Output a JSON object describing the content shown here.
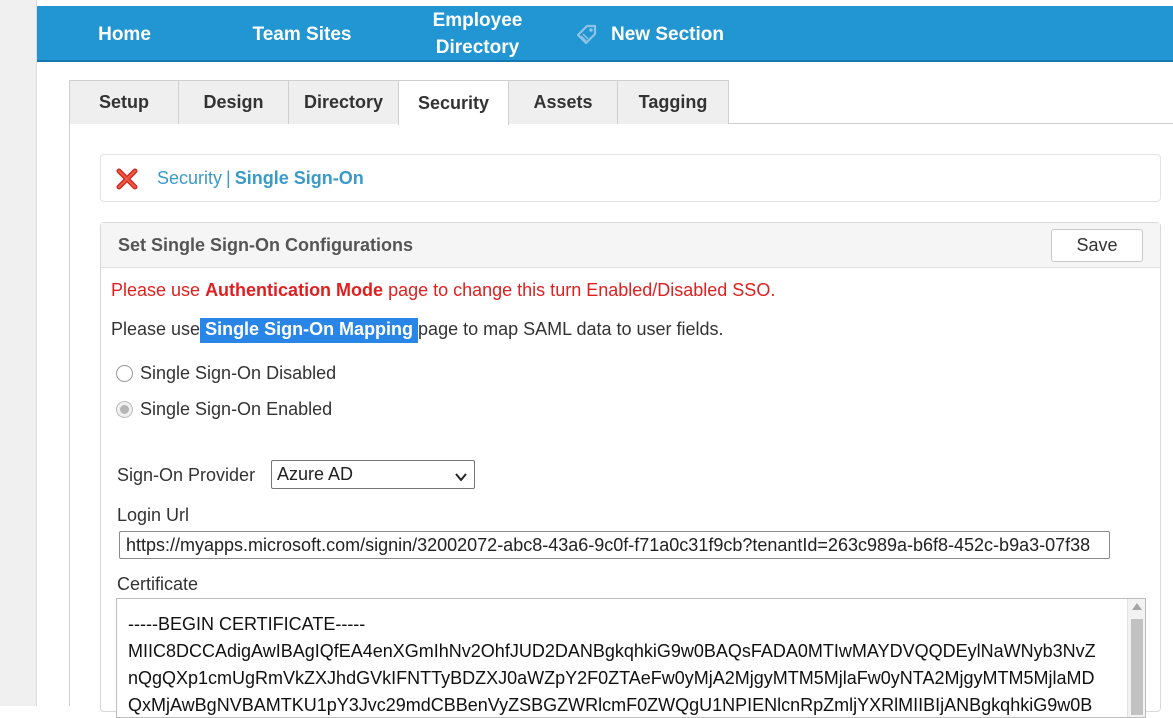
{
  "nav": {
    "home": "Home",
    "team_sites": "Team Sites",
    "employee_directory_line1": "Employee",
    "employee_directory_line2": "Directory",
    "new_section": "New Section"
  },
  "tabs": [
    {
      "label": "Setup"
    },
    {
      "label": "Design"
    },
    {
      "label": "Directory"
    },
    {
      "label": "Security",
      "active": true
    },
    {
      "label": "Assets"
    },
    {
      "label": "Tagging"
    }
  ],
  "breadcrumb": {
    "parent": "Security",
    "separator": "|",
    "current": "Single Sign-On"
  },
  "panel": {
    "title": "Set Single Sign-On Configurations",
    "save_label": "Save"
  },
  "warning": {
    "prefix": "Please use ",
    "link": "Authentication Mode",
    "suffix": " page to change this turn Enabled/Disabled SSO."
  },
  "info": {
    "prefix": "Please use",
    "highlight": "Single Sign-On Mapping",
    "suffix": "page to map SAML data to user fields."
  },
  "sso_options": {
    "disabled_label": "Single Sign-On Disabled",
    "enabled_label": "Single Sign-On Enabled",
    "selected": "enabled"
  },
  "provider": {
    "label": "Sign-On Provider",
    "value": "Azure AD"
  },
  "login": {
    "label": "Login Url",
    "value": "https://myapps.microsoft.com/signin/32002072-abc8-43a6-9c0f-f71a0c31f9cb?tenantId=263c989a-b6f8-452c-b9a3-07f38"
  },
  "certificate": {
    "label": "Certificate",
    "lines": [
      "-----BEGIN CERTIFICATE-----",
      "MIIC8DCCAdigAwIBAgIQfEA4enXGmIhNv2OhfJUD2DANBgkqhkiG9w0BAQsFADA0MTIwMAYDVQQDEylNaWNyb3NvZ",
      "nQgQXp1cmUgRmVkZXJhdGVkIFNTTyBDZXJ0aWZpY2F0ZTAeFw0yMjA2MjgyMTM5MjlaFw0yNTA2MjgyMTM5MjlaMD",
      "QxMjAwBgNVBAMTKU1pY3Jvc29mdCBBenVyZSBGZWRlcmF0ZWQgU1NPIENlcnRpZmljYXRlMIIBIjANBgkqhkiG9w0B"
    ]
  },
  "colors": {
    "nav_bg": "#2196d3",
    "link": "#3a9ac9",
    "warning": "#e02020",
    "highlight": "#2a86e6"
  }
}
